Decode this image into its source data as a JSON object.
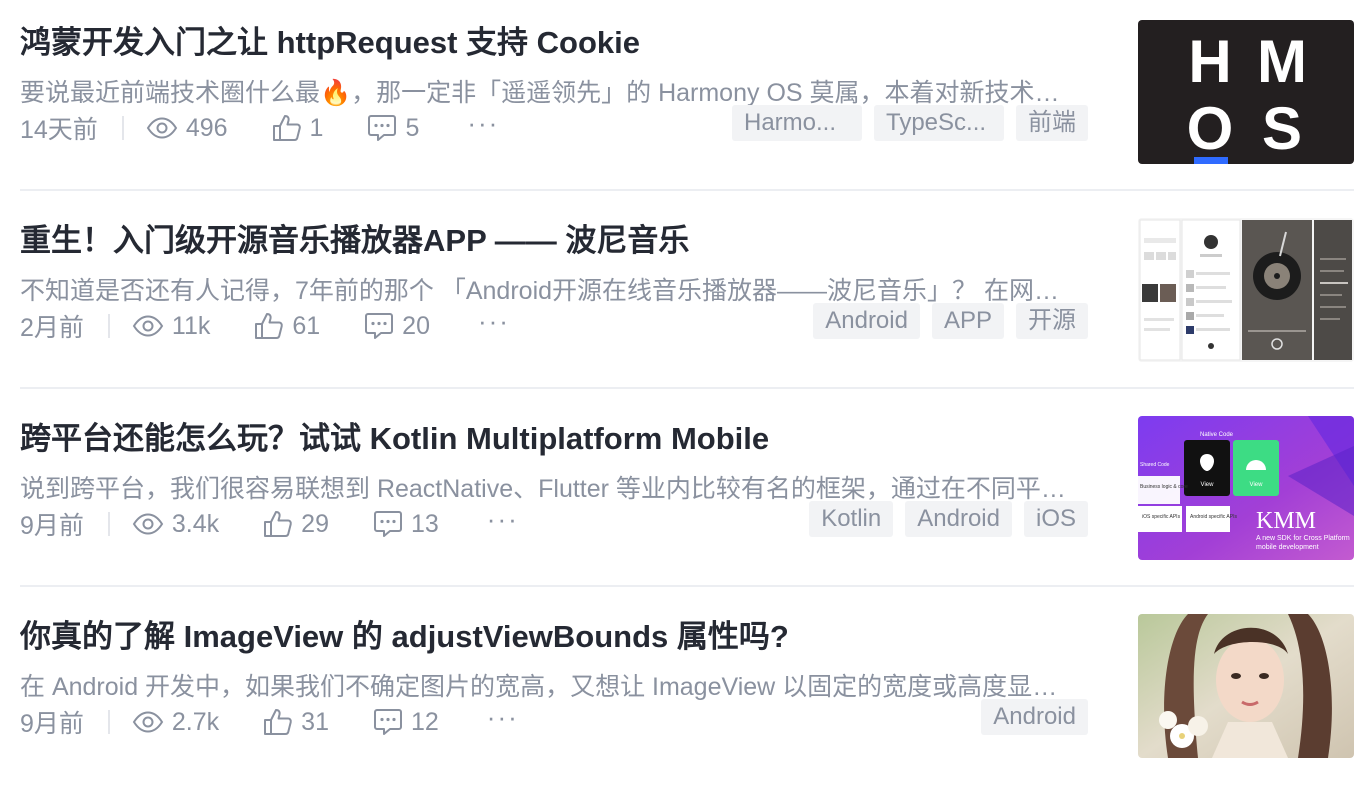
{
  "articles": [
    {
      "title": "鸿蒙开发入门之让 httpRequest 支持 Cookie",
      "abstract": "要说最近前端技术圈什么最🔥，那一定非「遥遥领先」的 Harmony OS 莫属，本着对新技术保持好奇的心态……",
      "date": "14天前",
      "views": "496",
      "likes": "1",
      "comments": "5",
      "more": "···",
      "tags": [
        "Harmo...",
        "TypeSc...",
        "前端"
      ],
      "thumb": {
        "kind": "hmos",
        "letters": [
          "H",
          "M",
          "O",
          "S"
        ],
        "bg": "#231f20",
        "accent": "#2f6bff"
      }
    },
    {
      "title": "重生！入门级开源音乐播放器APP —— 波尼音乐",
      "abstract": "不知道是否还有人记得，7年前的那个 「Android开源在线音乐播放器——波尼音乐」？ 在网上……",
      "date": "2月前",
      "views": "11k",
      "likes": "61",
      "comments": "20",
      "more": "···",
      "tags": [
        "Android",
        "APP",
        "开源"
      ],
      "thumb": {
        "kind": "music"
      }
    },
    {
      "title": "跨平台还能怎么玩？试试 Kotlin Multiplatform Mobile",
      "abstract": "说到跨平台，我们很容易联想到 ReactNative、Flutter 等业内比较有名的框架，通过在不同平台……",
      "date": "9月前",
      "views": "3.4k",
      "likes": "29",
      "comments": "13",
      "more": "···",
      "tags": [
        "Kotlin",
        "Android",
        "iOS"
      ],
      "thumb": {
        "kind": "kmm",
        "native_code": "Native Code",
        "shared_code": "Shared Code",
        "business": "Business\nlogic & core",
        "view": "View",
        "ios_apis": "iOS\nspecific APIs",
        "android_apis": "Android\nspecific APIs",
        "kmm": "KMM",
        "kmm_sub1": "A new SDK for Cross Platform",
        "kmm_sub2": "mobile development"
      }
    },
    {
      "title": "你真的了解 ImageView 的 adjustViewBounds 属性吗?",
      "abstract": "在 Android 开发中，如果我们不确定图片的宽高，又想让 ImageView 以固定的宽度或高度显示……",
      "date": "9月前",
      "views": "2.7k",
      "likes": "31",
      "comments": "12",
      "more": "···",
      "tags": [
        "Android"
      ],
      "thumb": {
        "kind": "photo"
      }
    }
  ]
}
